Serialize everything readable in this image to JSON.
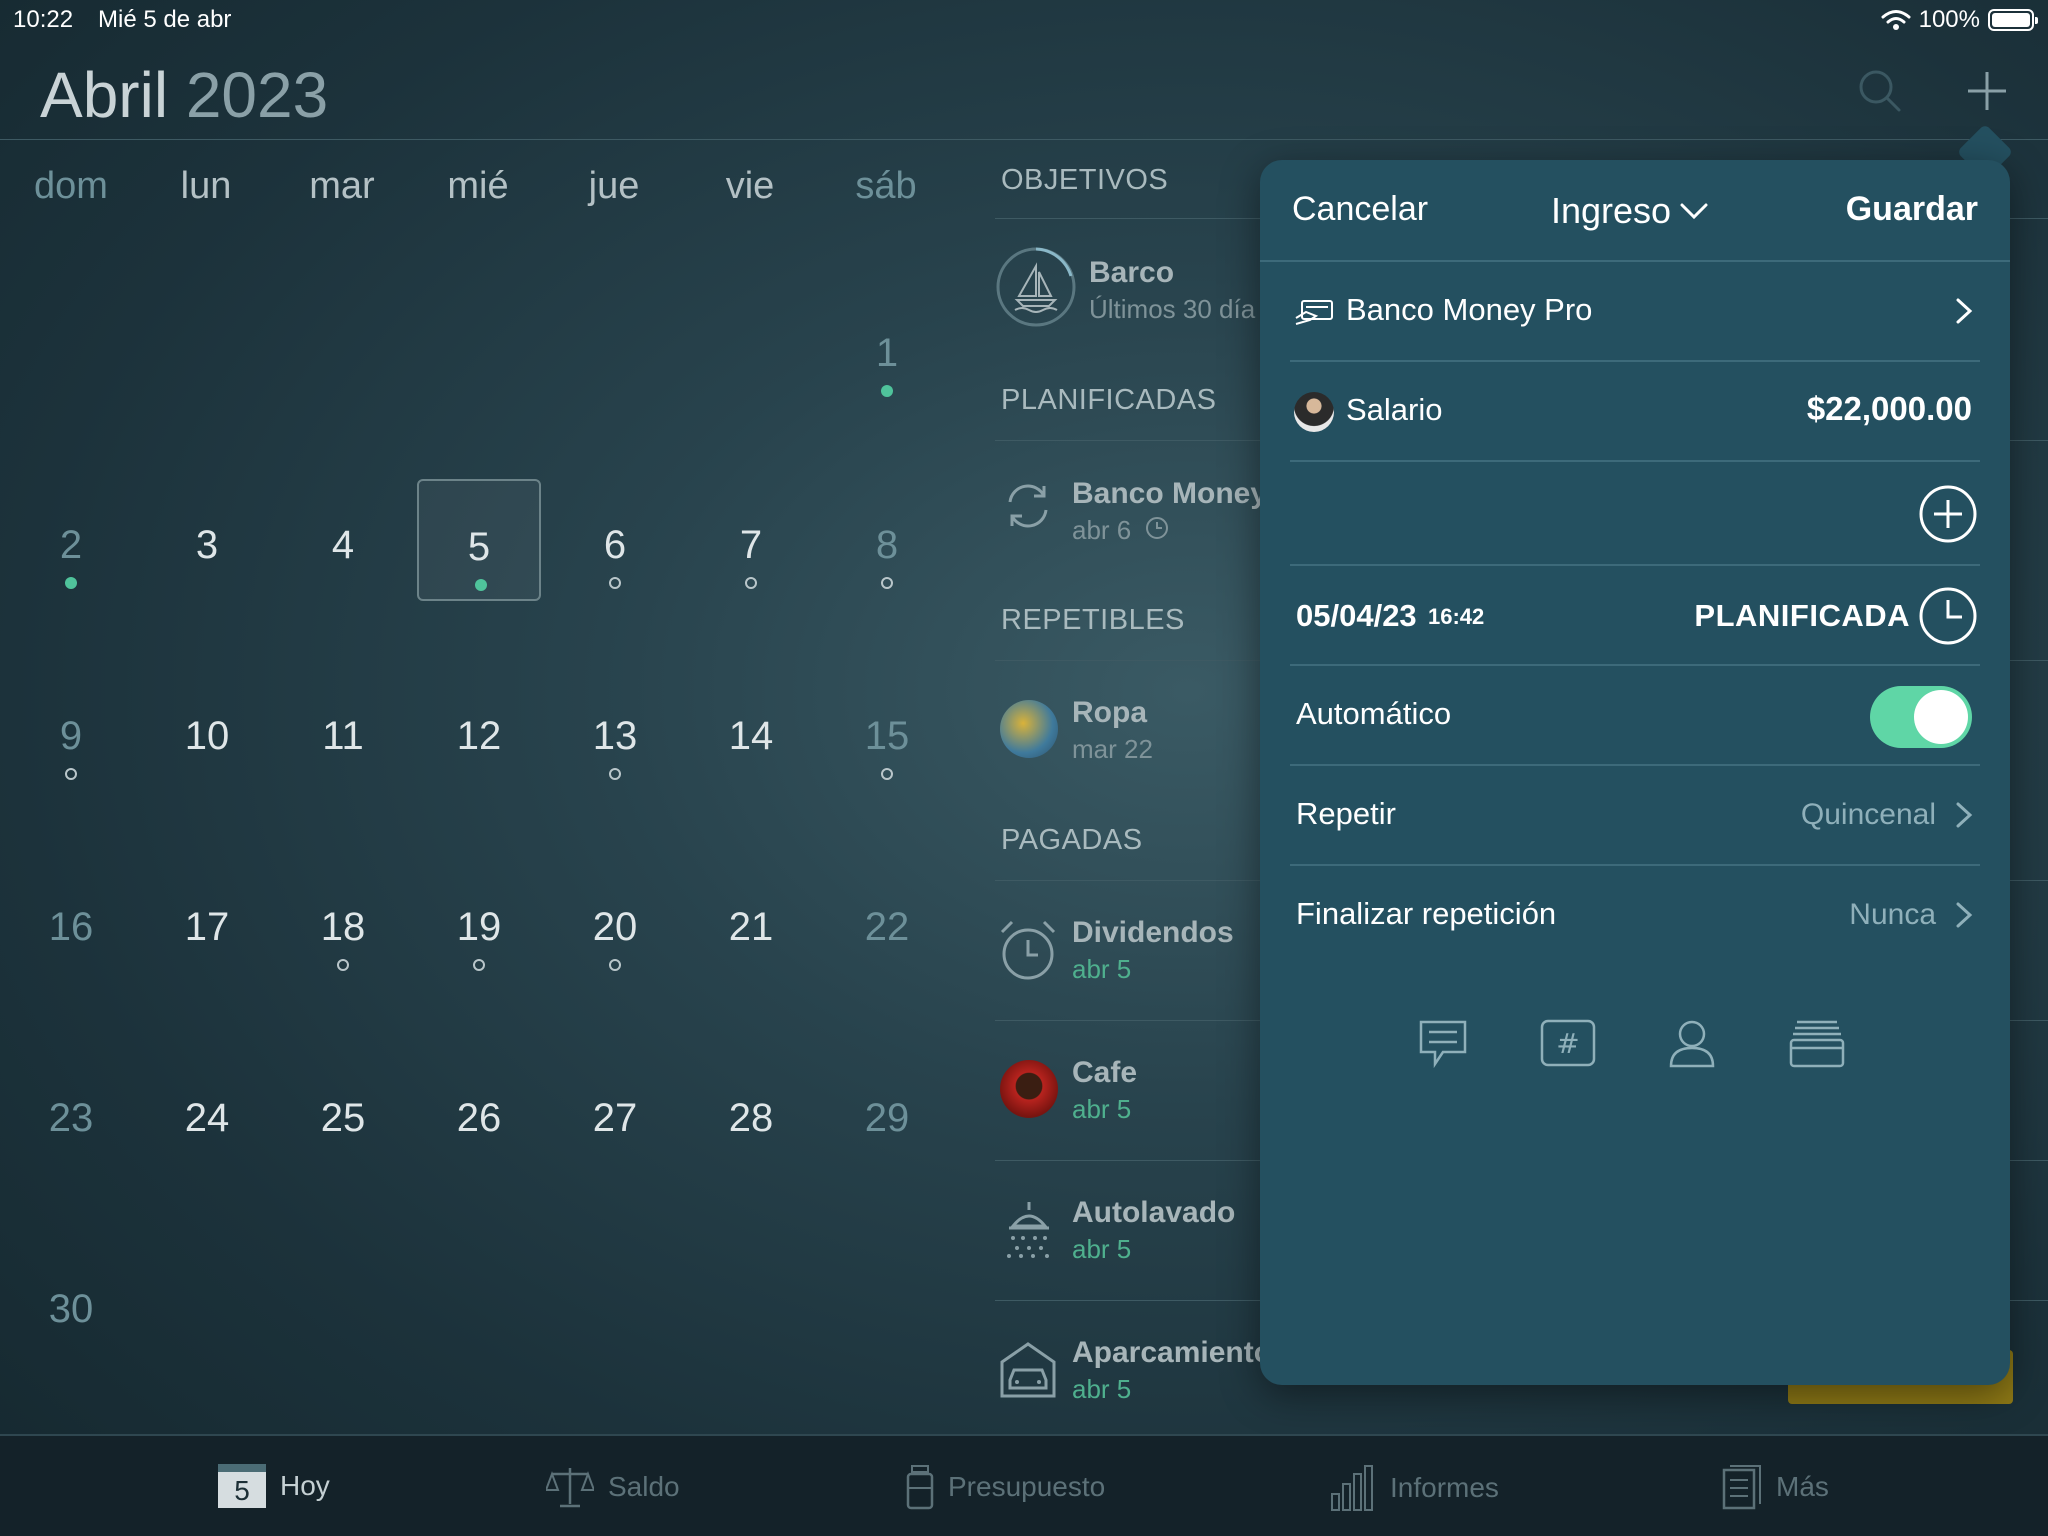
{
  "status_bar": {
    "time": "10:22",
    "date": "Mié 5 de abr",
    "battery": "100%"
  },
  "header": {
    "month": "Abril",
    "year": "2023",
    "search_icon": "search-icon",
    "add_icon": "plus-icon"
  },
  "calendar": {
    "weekdays": [
      "dom",
      "lun",
      "mar",
      "mié",
      "jue",
      "vie",
      "sáb"
    ],
    "today": "5",
    "days": [
      "1",
      "2",
      "3",
      "4",
      "5",
      "6",
      "7",
      "8",
      "9",
      "10",
      "11",
      "12",
      "13",
      "14",
      "15",
      "16",
      "17",
      "18",
      "19",
      "20",
      "21",
      "22",
      "23",
      "24",
      "25",
      "26",
      "27",
      "28",
      "29",
      "30"
    ]
  },
  "list": {
    "sections": {
      "goals": "OBJETIVOS",
      "planned": "PLANIFICADAS",
      "recurring": "REPETIBLES",
      "paid": "PAGADAS"
    },
    "goal_item": {
      "title": "Barco",
      "subtitle": "Últimos 30 día"
    },
    "planned_item": {
      "title": "Banco Money",
      "subtitle": "abr 6"
    },
    "recurring_item": {
      "title": "Ropa",
      "subtitle": "mar 22"
    },
    "paid_items": [
      {
        "title": "Dividendos",
        "subtitle": "abr 5"
      },
      {
        "title": "Cafe",
        "subtitle": "abr 5"
      },
      {
        "title": "Autolavado",
        "subtitle": "abr 5"
      },
      {
        "title": "Aparcamiento",
        "subtitle": "abr 5"
      }
    ]
  },
  "popover": {
    "cancel": "Cancelar",
    "type": "Ingreso",
    "save": "Guardar",
    "account": "Banco Money Pro",
    "category": "Salario",
    "amount": "$22,000.00",
    "date": "05/04/23",
    "time": "16:42",
    "status": "PLANIFICADA",
    "automatic_label": "Automático",
    "automatic_on": true,
    "repeat_label": "Repetir",
    "repeat_value": "Quincenal",
    "end_label": "Finalizar repetición",
    "end_value": "Nunca"
  },
  "tabbar": {
    "today_day": "5",
    "tabs": [
      "Hoy",
      "Saldo",
      "Presupuesto",
      "Informes",
      "Más"
    ]
  },
  "colors": {
    "accent_green": "#4fc39b",
    "toggle_on": "#5fd6a6",
    "popover_bg": "#245060",
    "warning_yellow": "#8f7a16"
  }
}
